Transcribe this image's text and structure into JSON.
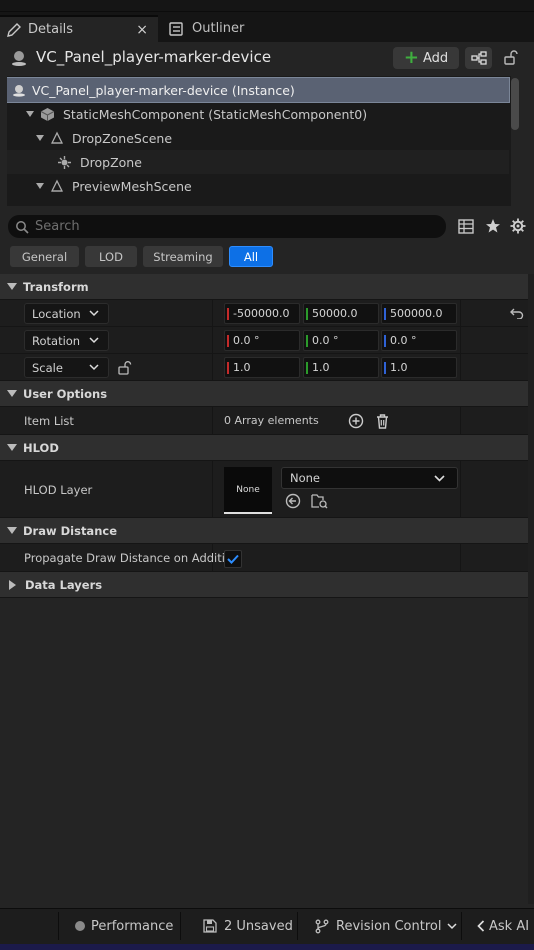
{
  "tabs": [
    {
      "label": "Details",
      "close": "×"
    },
    {
      "label": "Outliner"
    }
  ],
  "header": {
    "title": "VC_Panel_player-marker-device",
    "add_label": "Add"
  },
  "tree": {
    "items": [
      {
        "label": "VC_Panel_player-marker-device (Instance)"
      },
      {
        "label": "StaticMeshComponent (StaticMeshComponent0)"
      },
      {
        "label": "DropZoneScene"
      },
      {
        "label": "DropZone"
      },
      {
        "label": "PreviewMeshScene"
      }
    ]
  },
  "search": {
    "placeholder": "Search"
  },
  "filters": [
    "General",
    "LOD",
    "Streaming",
    "All"
  ],
  "active_filter": "All",
  "sections": {
    "transform": "Transform",
    "user_options": "User Options",
    "hlod": "HLOD",
    "draw_distance": "Draw Distance",
    "data_layers": "Data Layers"
  },
  "transform": {
    "location": {
      "label": "Location",
      "x": "-500000.0",
      "y": "50000.0",
      "z": "500000.0"
    },
    "rotation": {
      "label": "Rotation",
      "x": "0.0 °",
      "y": "0.0 °",
      "z": "0.0 °"
    },
    "scale": {
      "label": "Scale",
      "x": "1.0",
      "y": "1.0",
      "z": "1.0"
    }
  },
  "user_options": {
    "item_list_label": "Item List",
    "item_list_value": "0 Array elements"
  },
  "hlod": {
    "label": "HLOD Layer",
    "thumb": "None",
    "value": "None"
  },
  "draw_distance": {
    "label": "Propagate Draw Distance on Additi...",
    "checked": true
  },
  "bottom": {
    "performance": "Performance",
    "unsaved": "2 Unsaved",
    "revision": "Revision Control",
    "ask_ai": "Ask AI"
  },
  "colors": {
    "accent": "#0d70e6",
    "selection": "#5a6273",
    "x_axis": "#c42a2a",
    "y_axis": "#2b9a2b",
    "z_axis": "#2f62d6"
  }
}
